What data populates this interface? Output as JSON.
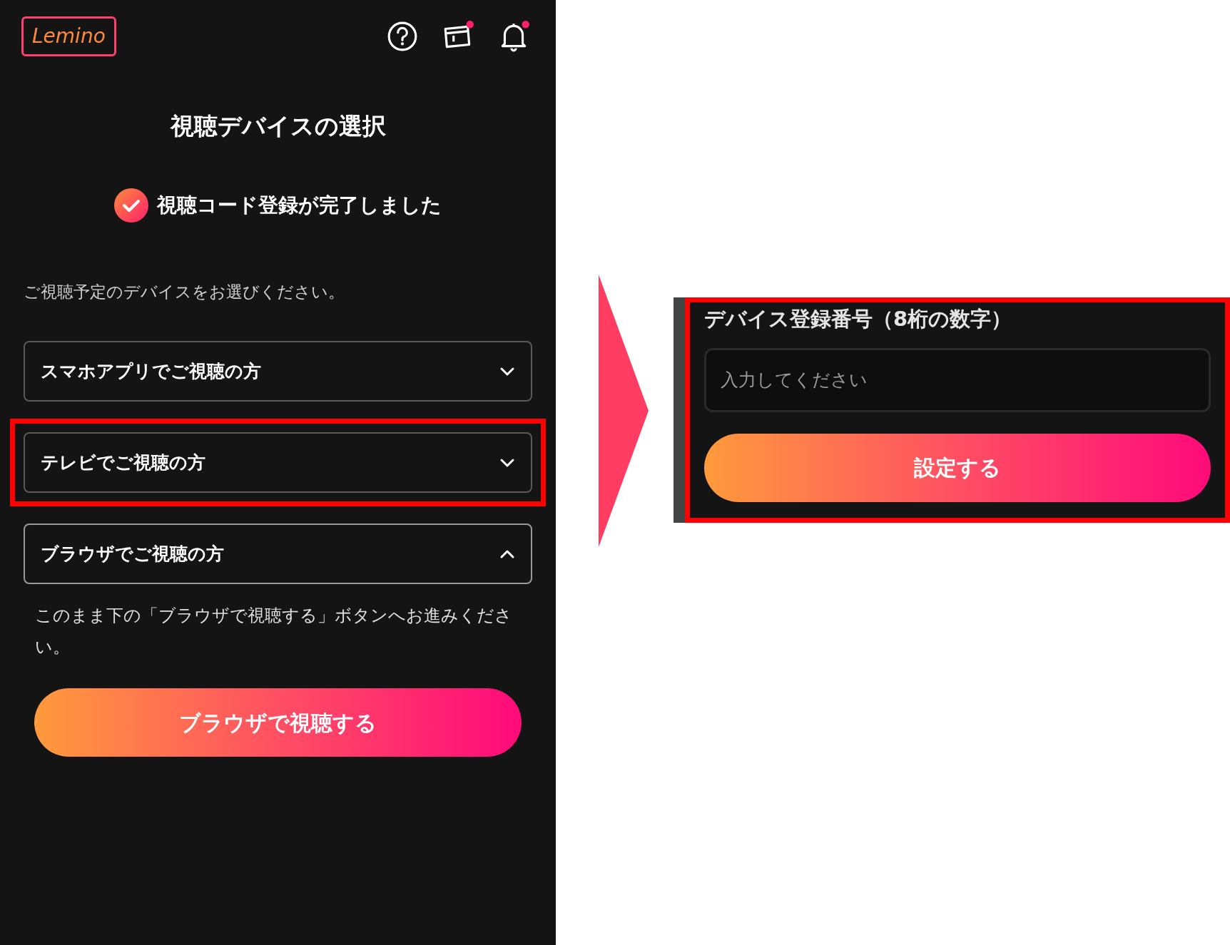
{
  "app": {
    "logo": "Lemino",
    "header_icons": [
      {
        "kind": "help",
        "badge": false
      },
      {
        "kind": "ticket",
        "badge": true
      },
      {
        "kind": "bell",
        "badge": true
      }
    ]
  },
  "title": "視聴デバイスの選択",
  "status": {
    "text": "視聴コード登録が完了しました"
  },
  "intro": "ご視聴予定のデバイスをお選びください。",
  "devices": [
    {
      "label": "スマホアプリでご視聴の方",
      "expanded": false,
      "highlighted": false
    },
    {
      "label": "テレビでご視聴の方",
      "expanded": false,
      "highlighted": true
    },
    {
      "label": "ブラウザでご視聴の方",
      "expanded": true,
      "highlighted": false,
      "body": "このまま下の「ブラウザで視聴する」ボタンへお進みください。"
    }
  ],
  "primary_button": "ブラウザで視聴する",
  "detail": {
    "label": "デバイス登録番号（8桁の数字）",
    "input": {
      "placeholder": "入力してください"
    },
    "button": "設定する",
    "highlighted": true
  }
}
